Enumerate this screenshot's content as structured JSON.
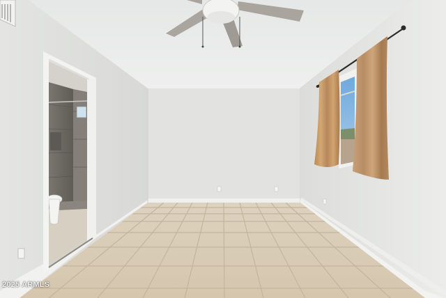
{
  "photo": {
    "watermark": "2025 ARMLS"
  },
  "colors": {
    "ceiling": "#e9ebea",
    "back_wall": "#e3e4e2",
    "left_wall": "#dedfdc",
    "right_wall": "#e6e7e5",
    "floor_tile": "#d8cbb6",
    "grout": "#bfb3a0",
    "curtain": "#c79a63",
    "fan_blade": "#a9a49d",
    "shower_tile": "#6e6a64"
  }
}
